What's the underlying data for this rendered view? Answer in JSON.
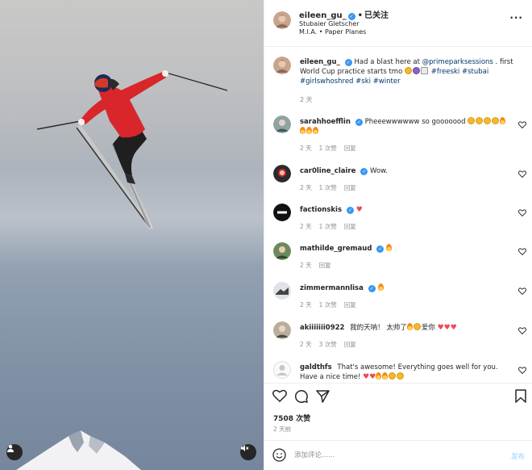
{
  "post": {
    "author": "eileen_gu_",
    "follow_dot": "•",
    "follow_label": "已关注",
    "location_line1": "Stubaier Gletscher",
    "location_line2": "M.I.A. • Paper Planes",
    "more": "..."
  },
  "caption": {
    "username": "eileen_gu_",
    "text_a": "Had a blast here at",
    "mention": "@primeparksessions",
    "text_b": ". first World Cup practice starts tmo",
    "hashtags": "#freeski #stubai #girlswhoshred #ski #winter",
    "time": "2 天"
  },
  "comments": [
    {
      "user": "sarahhoefflin",
      "verified": true,
      "text": "Pheeewwwwww so gooooood",
      "emoji": [
        "face",
        "face",
        "face",
        "face",
        "fire"
      ],
      "emoji2": [
        "fire",
        "fire",
        "fire"
      ],
      "time": "2 天",
      "likes": "1 次赞",
      "reply": "回复",
      "avatar": "avatar-sarah"
    },
    {
      "user": "car0line_claire",
      "verified": true,
      "text": "Wow.",
      "time": "2 天",
      "likes": "1 次赞",
      "reply": "回复",
      "avatar": "avatar-caroline"
    },
    {
      "user": "factionskis",
      "verified": true,
      "text": "",
      "emoji": [
        "heart"
      ],
      "time": "2 天",
      "likes": "1 次赞",
      "reply": "回复",
      "avatar": "avatar-faction"
    },
    {
      "user": "mathilde_gremaud",
      "verified": true,
      "text": "",
      "emoji": [
        "fire"
      ],
      "time": "2 天",
      "likes": "",
      "reply": "回复",
      "avatar": "avatar-mathilde"
    },
    {
      "user": "zimmermannlisa",
      "verified": true,
      "text": "",
      "emoji": [
        "fire"
      ],
      "time": "2 天",
      "likes": "1 次赞",
      "reply": "回复",
      "avatar": "avatar-lisa"
    },
    {
      "user": "akiiiiiii0922",
      "verified": false,
      "text": "我的天呐！ 太帅了",
      "emoji": [
        "fire",
        "face"
      ],
      "text2": "爱你",
      "emoji2": [
        "heart",
        "heart",
        "heart"
      ],
      "time": "2 天",
      "likes": "3 次赞",
      "reply": "回复",
      "avatar": "avatar-aki"
    },
    {
      "user": "galdthfs",
      "verified": false,
      "text": "That's awesome! Everything goes well for you. Have a nice time!",
      "emoji": [
        "heart",
        "heart",
        "fire",
        "fire",
        "face",
        "face"
      ],
      "time": "",
      "likes": "",
      "reply": "",
      "avatar": "avatar-default"
    }
  ],
  "stats": {
    "likes": "7508 次赞",
    "time": "2 天前"
  },
  "add_comment": {
    "placeholder": "添加评论......",
    "post_label": "发布"
  },
  "icons": {
    "heart": "heart-icon",
    "comment": "comment-icon",
    "share": "share-icon",
    "save": "bookmark-icon",
    "emoji": "smiley-icon",
    "tag": "user-tag-icon",
    "mute": "speaker-muted-icon"
  },
  "colors": {
    "verified": "#3897f0",
    "link": "#00376b",
    "post_disabled": "#b2dffc",
    "muted_text": "#8e8e8e"
  }
}
